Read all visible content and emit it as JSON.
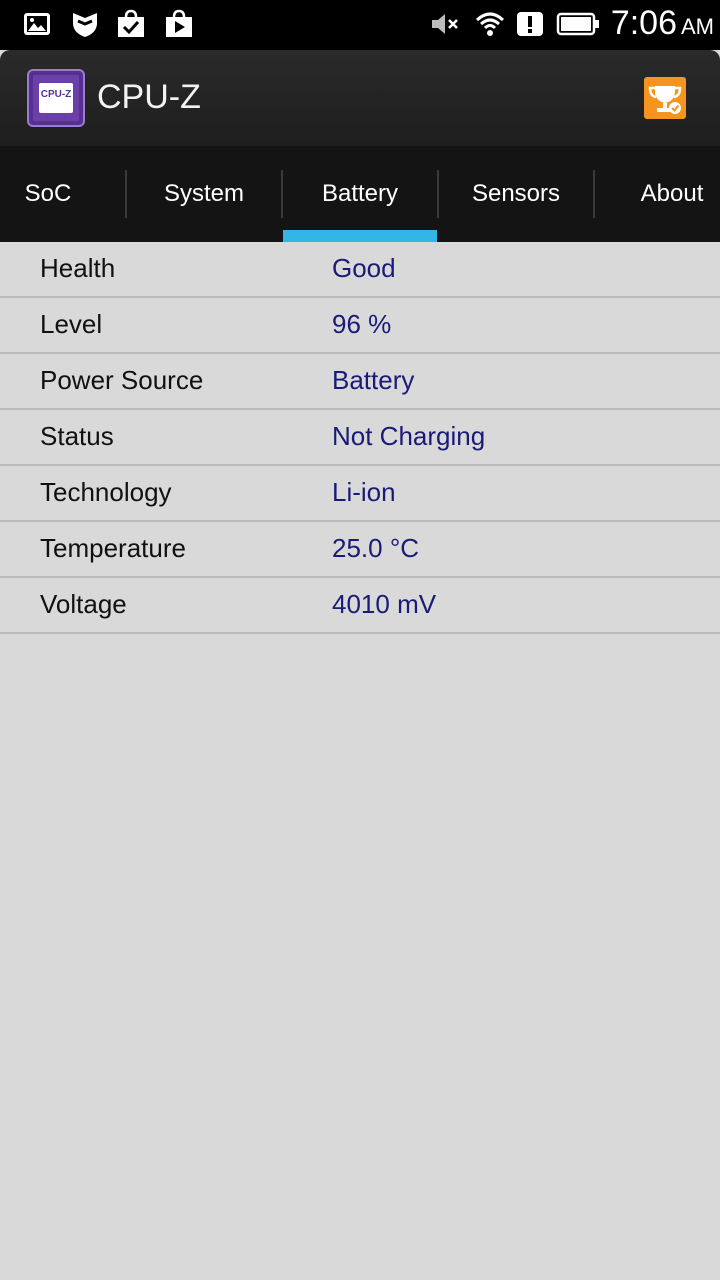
{
  "status_bar": {
    "time": "7:06",
    "ampm": "AM",
    "icons": [
      "gallery-icon",
      "shield-icon",
      "shopping-bag-check-icon",
      "play-store-icon",
      "volume-muted-icon",
      "wifi-icon",
      "alert-icon",
      "battery-icon"
    ]
  },
  "app_bar": {
    "title": "CPU-Z",
    "logo_text": "CPU-Z",
    "action_icon": "trophy-icon",
    "accent_color": "#f7941d"
  },
  "tabs": [
    {
      "label": "SoC",
      "selected": false
    },
    {
      "label": "System",
      "selected": false
    },
    {
      "label": "Battery",
      "selected": true
    },
    {
      "label": "Sensors",
      "selected": false
    },
    {
      "label": "About",
      "selected": false
    }
  ],
  "tab_indicator_color": "#33b5e5",
  "battery_info": [
    {
      "label": "Health",
      "value": "Good"
    },
    {
      "label": "Level",
      "value": "96 %"
    },
    {
      "label": "Power Source",
      "value": "Battery"
    },
    {
      "label": "Status",
      "value": "Not Charging"
    },
    {
      "label": "Technology",
      "value": "Li-ion"
    },
    {
      "label": "Temperature",
      "value": "25.0 °C"
    },
    {
      "label": "Voltage",
      "value": "4010 mV"
    }
  ]
}
